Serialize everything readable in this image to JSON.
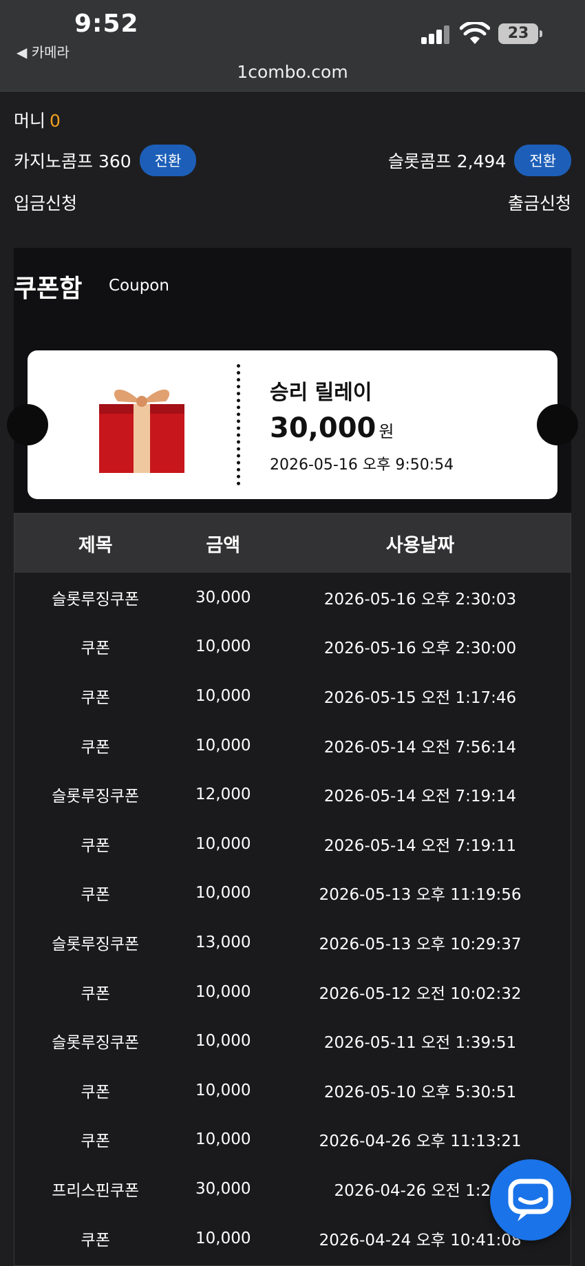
{
  "status_bar": {
    "time": "9:52",
    "back_label": "◀ 카메라",
    "url": "1combo.com",
    "battery": "23"
  },
  "account": {
    "money_label": "머니",
    "money_value": "0",
    "casino_comp_label": "카지노콤프 360",
    "slot_comp_label": "슬롯콤프 2,494",
    "convert_label": "전환",
    "deposit_label": "입금신청",
    "withdraw_label": "출금신청"
  },
  "coupon_box": {
    "title": "쿠폰함",
    "subtitle": "Coupon",
    "ticket": {
      "name": "승리 릴레이",
      "amount": "30,000",
      "unit": "원",
      "date": "2026-05-16 오후 9:50:54"
    }
  },
  "table": {
    "headers": [
      "제목",
      "금액",
      "사용날짜"
    ],
    "rows": [
      {
        "title": "슬롯루징쿠폰",
        "amount": "30,000",
        "date": "2026-05-16 오후 2:30:03"
      },
      {
        "title": "쿠폰",
        "amount": "10,000",
        "date": "2026-05-16 오후 2:30:00"
      },
      {
        "title": "쿠폰",
        "amount": "10,000",
        "date": "2026-05-15 오전 1:17:46"
      },
      {
        "title": "쿠폰",
        "amount": "10,000",
        "date": "2026-05-14 오전 7:56:14"
      },
      {
        "title": "슬롯루징쿠폰",
        "amount": "12,000",
        "date": "2026-05-14 오전 7:19:14"
      },
      {
        "title": "쿠폰",
        "amount": "10,000",
        "date": "2026-05-14 오전 7:19:11"
      },
      {
        "title": "쿠폰",
        "amount": "10,000",
        "date": "2026-05-13 오후 11:19:56"
      },
      {
        "title": "슬롯루징쿠폰",
        "amount": "13,000",
        "date": "2026-05-13 오후 10:29:37"
      },
      {
        "title": "쿠폰",
        "amount": "10,000",
        "date": "2026-05-12 오전 10:02:32"
      },
      {
        "title": "슬롯루징쿠폰",
        "amount": "10,000",
        "date": "2026-05-11 오전 1:39:51"
      },
      {
        "title": "쿠폰",
        "amount": "10,000",
        "date": "2026-05-10 오후 5:30:51"
      },
      {
        "title": "쿠폰",
        "amount": "10,000",
        "date": "2026-04-26 오후 11:13:21"
      },
      {
        "title": "프리스핀쿠폰",
        "amount": "30,000",
        "date": "2026-04-26 오전 1:20:"
      },
      {
        "title": "쿠폰",
        "amount": "10,000",
        "date": "2026-04-24 오후 10:41:08"
      }
    ]
  },
  "colors": {
    "accent_blue": "#1d5fb8",
    "money_value": "#f0a020",
    "chat_button": "#1a73e8"
  },
  "icons": [
    "signal-icon",
    "wifi-icon",
    "battery-icon",
    "gift-box-icon",
    "chat-bubble-icon"
  ]
}
